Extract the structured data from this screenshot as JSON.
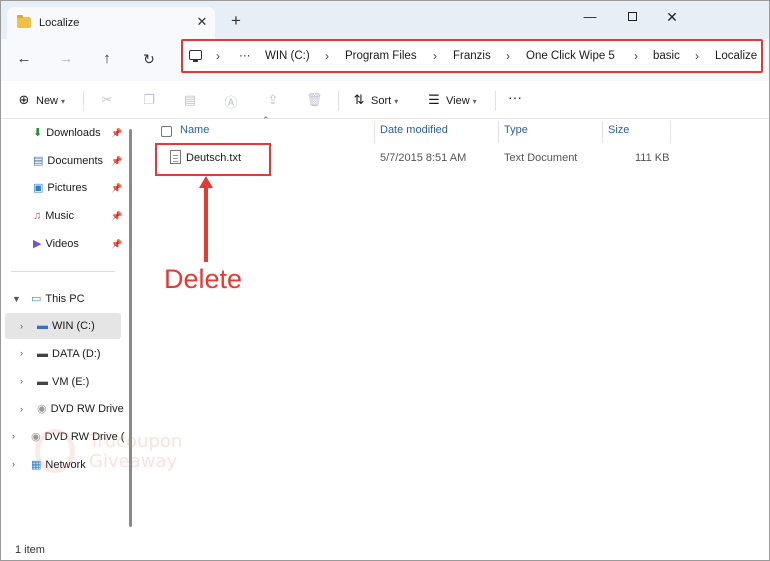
{
  "tab": {
    "title": "Localize",
    "close": "✕",
    "new_tab": "+"
  },
  "window_controls": {
    "minimize": "—",
    "close": "✕"
  },
  "nav": {
    "back": "←",
    "forward": "→",
    "up": "↑",
    "refresh": "↻"
  },
  "breadcrumb": {
    "more": "···",
    "separator": "›",
    "items": [
      "WIN (C:)",
      "Program Files",
      "Franzis",
      "One Click Wipe 5",
      "basic",
      "Localize"
    ]
  },
  "commands": {
    "new": "New",
    "sort": "Sort",
    "view": "View",
    "more": "···"
  },
  "sidebar": {
    "quick": [
      {
        "label": "Downloads",
        "icon": "download-icon"
      },
      {
        "label": "Documents",
        "icon": "documents-icon"
      },
      {
        "label": "Pictures",
        "icon": "pictures-icon"
      },
      {
        "label": "Music",
        "icon": "music-icon"
      },
      {
        "label": "Videos",
        "icon": "videos-icon"
      }
    ],
    "this_pc": "This PC",
    "drives": [
      "WIN (C:)",
      "DATA (D:)",
      "VM (E:)",
      "DVD RW Drive"
    ],
    "dvd2": "DVD RW Drive (",
    "network": "Network"
  },
  "columns": {
    "name": "Name",
    "date": "Date modified",
    "type": "Type",
    "size": "Size"
  },
  "files": [
    {
      "name": "Deutsch.txt",
      "date": "5/7/2015 8:51 AM",
      "type": "Text Document",
      "size": "111 KB"
    }
  ],
  "annotation": {
    "label": "Delete",
    "color": "#e53935"
  },
  "watermark": {
    "line1": "Trucoupon",
    "line2": "Giveaway"
  },
  "status": {
    "text": "1 item"
  },
  "colors": {
    "accent": "#2a5fa0",
    "highlight": "#e53935",
    "folder": "#f2c04a"
  }
}
